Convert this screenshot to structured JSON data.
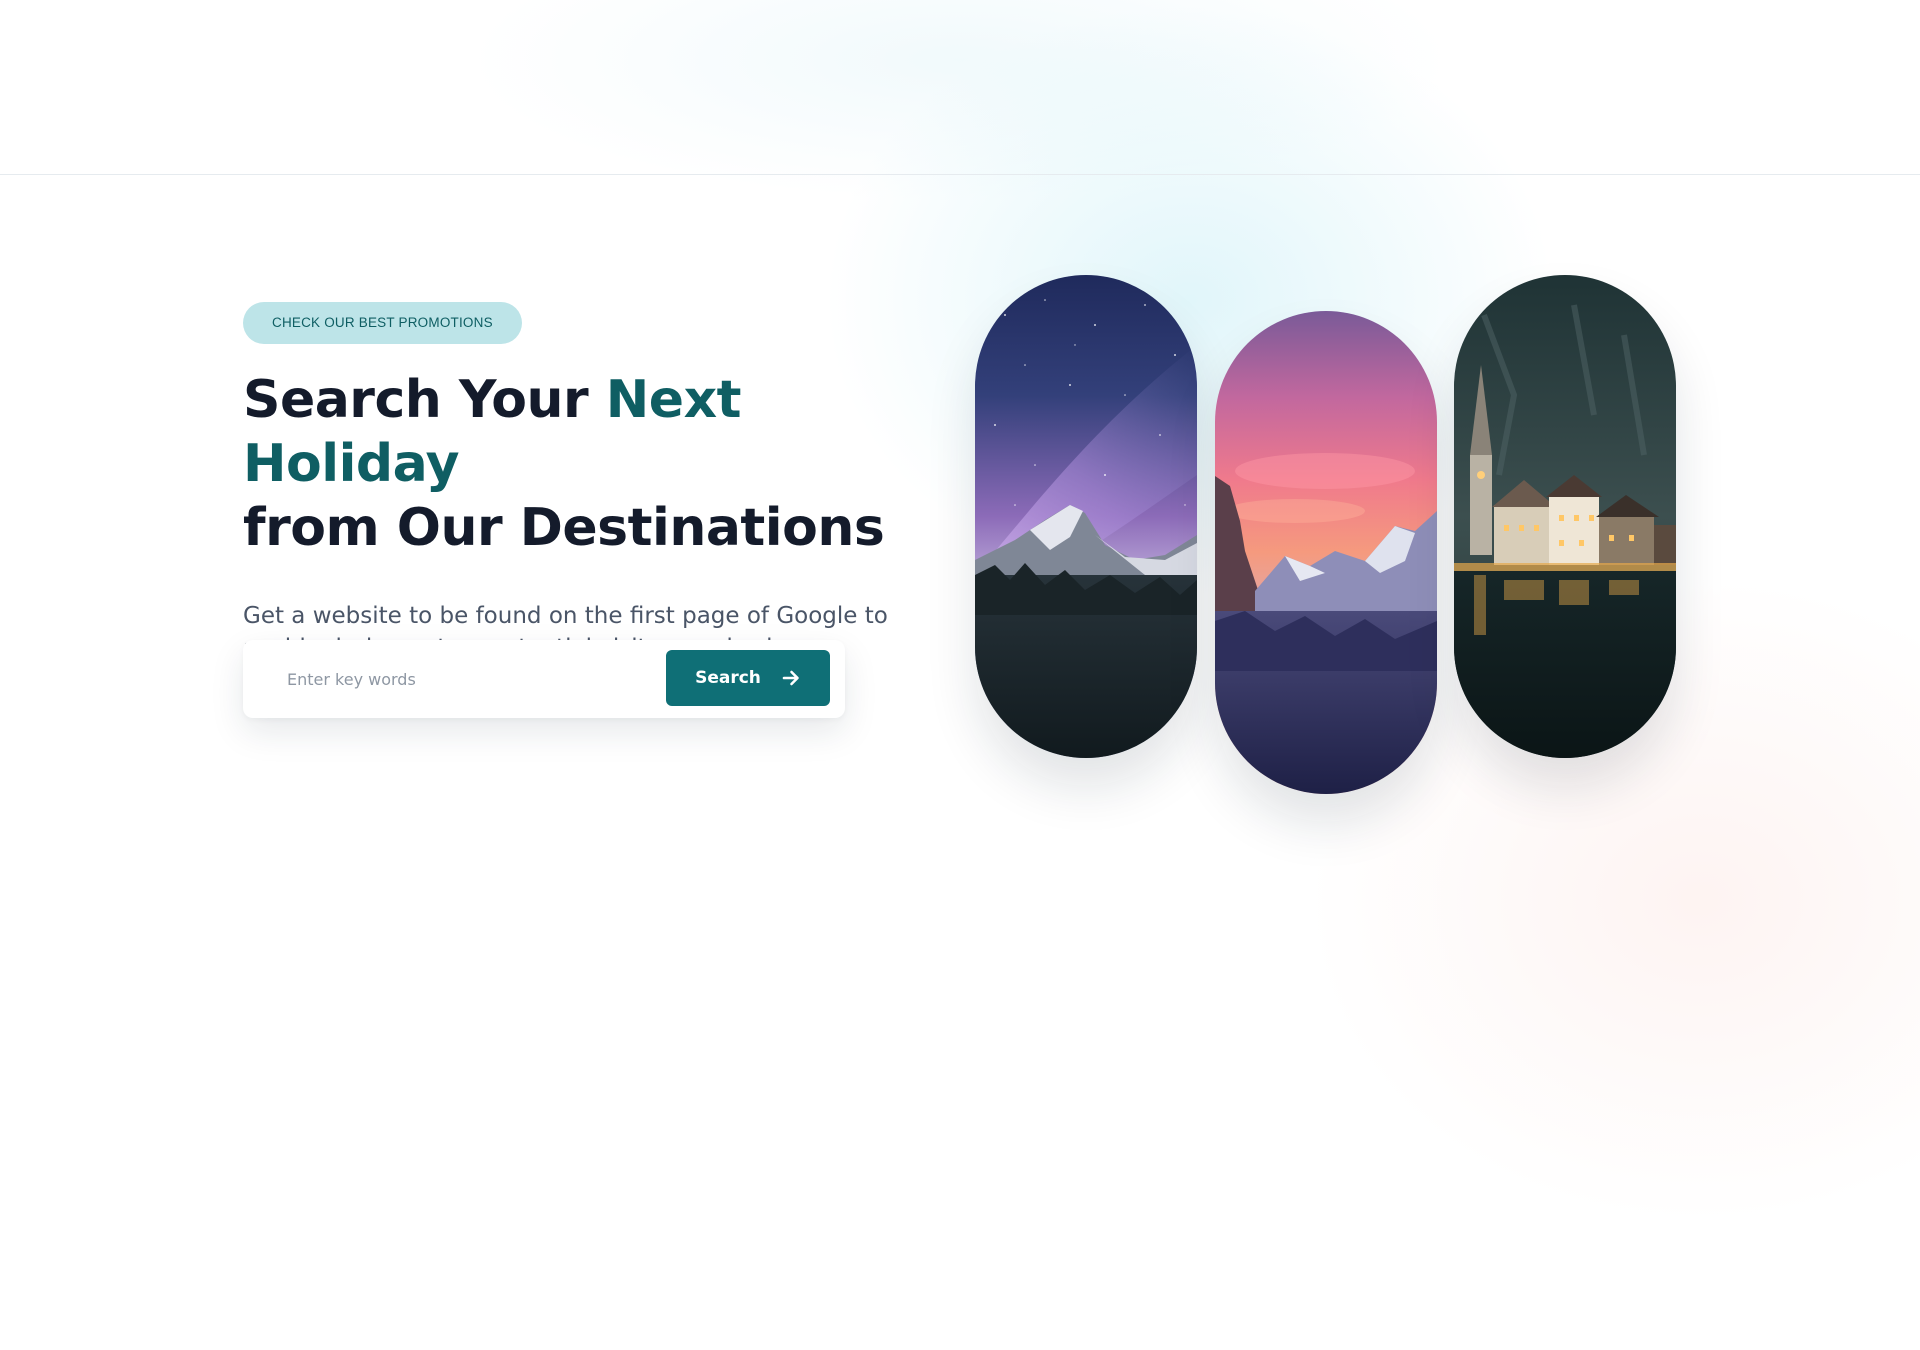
{
  "hero": {
    "badge": "CHECK OUR BEST PROMOTIONS",
    "headline_part1": "Search Your ",
    "headline_accent": "Next Holiday",
    "headline_part2": "from Our Destinations",
    "subtext": "Get a website to be found on the first page of Google to avoid missing out on potential visitors and sales."
  },
  "search": {
    "placeholder": "Enter key words",
    "value": "",
    "button_label": "Search",
    "button_icon": "arrow-right-icon"
  },
  "gallery": {
    "images": [
      {
        "name": "milky-way-mountain-photo"
      },
      {
        "name": "sunset-valley-photo"
      },
      {
        "name": "lakeside-village-night-photo"
      }
    ]
  },
  "colors": {
    "accent": "#0f5e63",
    "button": "#0f6f76",
    "badge_bg": "#bde4e8",
    "heading": "#141b2b",
    "body_text": "#4a5567"
  }
}
